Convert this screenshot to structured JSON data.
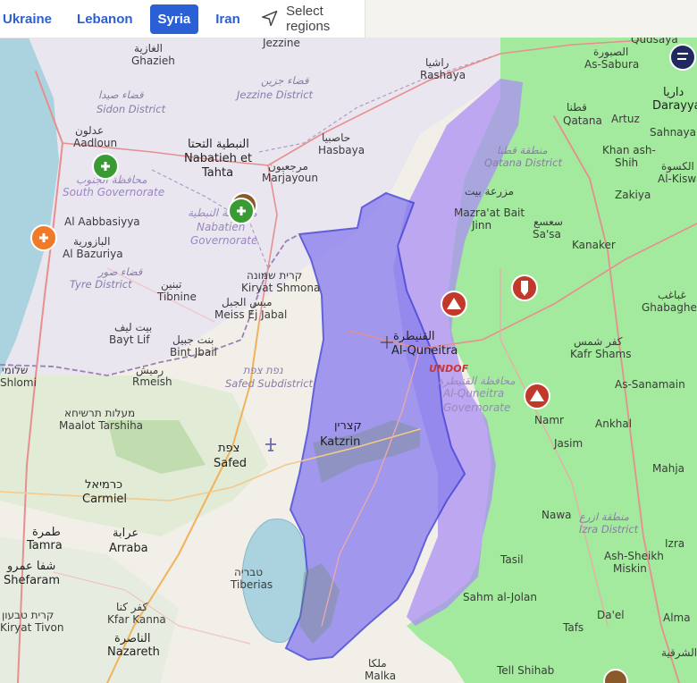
{
  "tabs": [
    {
      "label": "Ukraine",
      "active": false
    },
    {
      "label": "Lebanon",
      "active": false
    },
    {
      "label": "Syria",
      "active": true
    },
    {
      "label": "Iran",
      "active": false
    }
  ],
  "select_regions_label": "Select regions",
  "colors": {
    "accent": "#2a5fd6",
    "syria_zone": "#9ee89a",
    "occupied_zone": "#9b8ff0",
    "occupied_border": "#3f3fd6",
    "sea": "#aad3df",
    "medical_marker": "#3a9b35",
    "strike_marker": "#c0392b",
    "orange_marker": "#f07a28"
  },
  "map_labels": {
    "ghazieh_ar": "الغازية",
    "ghazieh": "Ghazieh",
    "sidon_district_ar": "قضاء صيدا",
    "sidon_district": "Sidon District",
    "aadloun_ar": "عدلون",
    "aadloun": "Aadloun",
    "south_gov_ar": "محافظة الجنوب",
    "south_gov": "South Governorate",
    "aabbasiyya": "Al Aabbasiyya",
    "bazuriya_ar": "البازورية",
    "bazuriya": "Al Bazuriya",
    "tyre_district_ar": "قضاء صور",
    "tyre_district": "Tyre District",
    "tibnine_ar": "تبنين",
    "tibnine": "Tibnine",
    "bayt_lif_ar": "بيت ليف",
    "bayt_lif": "Bayt Lif",
    "shlomi_ar": "שלומי",
    "shlomi": "Shlomi",
    "rmeish_ar": "رميش",
    "rmeish": "Rmeish",
    "jezzine": "Jezzine",
    "jezzine_district_ar": "قضاء جزين",
    "jezzine_district": "Jezzine District",
    "nabatieh_ar": "النبطية التحتا",
    "nabatieh": "Nabatieh et",
    "tahta": "Tahta",
    "nabatieh_gov_ar": "محافظة النبطية",
    "nabatieh_gov": "Nabatieh",
    "governorate": "Governorate",
    "marjayoun_ar": "مرجعيون",
    "marjayoun": "Marjayoun",
    "rashaya_ar": "راشيا",
    "rashaya": "Rashaya",
    "hasbaya_ar": "حاصبيا",
    "hasbaya": "Hasbaya",
    "kiryat_shmona_ar": "קרית שמונה",
    "kiryat_shmona": "Kiryat Shmona",
    "meiss_ar": "ميس الجبل",
    "meiss": "Meiss Ej Jabal",
    "bint_jbail_ar": "بنت جبيل",
    "bint_jbail": "Bint Jbail",
    "safed_sub_ar": "נפת צפת",
    "safed_sub": "Safed Subdistrict",
    "maalot_ar": "מעלות תרשיחא",
    "maalot": "Maalot Tarshiha",
    "safed_ar": "צפת",
    "safed": "Safed",
    "karmiel_ar": "כרמיאל",
    "karmiel": "Carmiel",
    "tamra_ar": "طمرة",
    "tamra": "Tamra",
    "arraba_ar": "عرابة",
    "arraba": "Arraba",
    "shefaram_ar": "شفا عمرو",
    "shefaram": "Shefaram",
    "tivon_ar": "קרית טבעון",
    "tivon": "Kiryat Tivon",
    "kafr_kanna_ar": "كفر كنا",
    "kafr_kanna": "Kfar Kanna",
    "nazareth_ar": "الناصرة",
    "nazareth": "Nazareth",
    "tiberias_ar": "טבריה",
    "tiberias": "Tiberias",
    "katzrin_ar": "קצרין",
    "katzrin": "Katzrin",
    "quneitra_ar": "القنيطرة",
    "quneitra": "Al-Quneitra",
    "undof": "UNDOF",
    "quneitra_gov_ar": "محافظة القنيطرة",
    "quneitra_gov": "Al-Quneitra",
    "quneitra_gov2": "Governorate",
    "qudsaya": "Qudsaya",
    "as_sabura_ar": "الصبورة",
    "as_sabura": "As-Sabura",
    "daraya_ar": "داريا",
    "darayya": "Darayya",
    "qatana_ar": "قطنا",
    "qatana": "Qatana",
    "artuz": "Artuz",
    "sahnaya": "Sahnaya",
    "qatana_district_ar": "منطقة قطنا",
    "qatana_district": "Qatana District",
    "khan_ash_shih": "Khan ash-",
    "shih": "Shih",
    "al_kiswa_ar": "الكسوة",
    "al_kiswa": "Al-Kiswa",
    "zakiya": "Zakiya",
    "mazraat_ar": "مزرعة بيت",
    "mazraat": "Mazra'at Bait",
    "jinn": "Jinn",
    "sasa_ar": "سعسع",
    "sasa": "Sa'sa",
    "kanaker": "Kanaker",
    "ghabagheb_ar": "غباغب",
    "ghabagheb": "Ghabagheb",
    "kafr_shams_ar": "كفر شمس",
    "kafr_shams": "Kafr Shams",
    "as_sanamain": "As-Sanamain",
    "namr": "Namr",
    "jasim": "Jasim",
    "ankhal": "Ankhal",
    "mahja": "Mahja",
    "nawa": "Nawa",
    "izra_district_ar": "منطقة ازرع",
    "izra_district": "Izra District",
    "tasil": "Tasil",
    "ash_sheikh": "Ash-Sheikh",
    "miskin": "Miskin",
    "izra": "Izra",
    "sahm": "Sahm al-Jolan",
    "daal": "Da'el",
    "tafs": "Tafs",
    "alma": "Alma",
    "malka_ar": "ملكا",
    "malka": "Malka",
    "tell_shihab": "Tell Shihab",
    "ash_shara_ar": "الشرقية"
  }
}
